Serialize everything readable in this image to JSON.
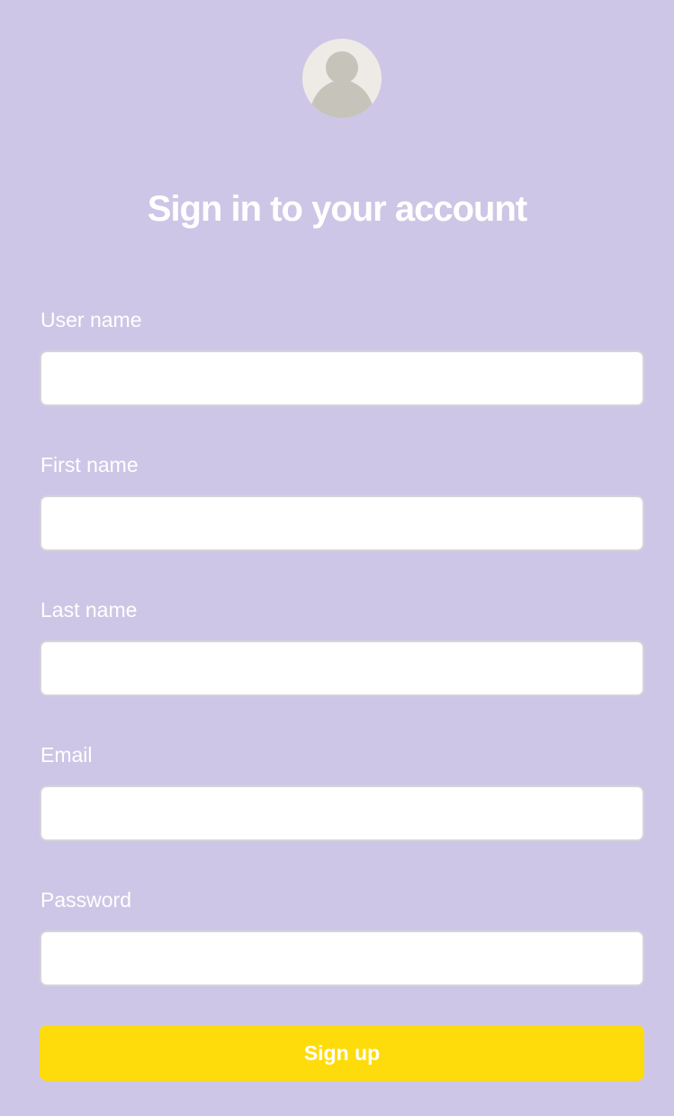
{
  "header": {
    "avatar_icon": "user-avatar-icon",
    "title": "Sign in to your account"
  },
  "form": {
    "fields": [
      {
        "label": "User name",
        "value": "",
        "type": "text"
      },
      {
        "label": "First name",
        "value": "",
        "type": "text"
      },
      {
        "label": "Last name",
        "value": "",
        "type": "text"
      },
      {
        "label": "Email",
        "value": "",
        "type": "email"
      },
      {
        "label": "Password",
        "value": "",
        "type": "password"
      }
    ],
    "submit_label": "Sign up"
  },
  "colors": {
    "background": "#cec6e6",
    "button": "#fedc0c",
    "text": "#ffffff",
    "avatar_bg": "#eeebe6",
    "avatar_fg": "#c6c3ba"
  }
}
